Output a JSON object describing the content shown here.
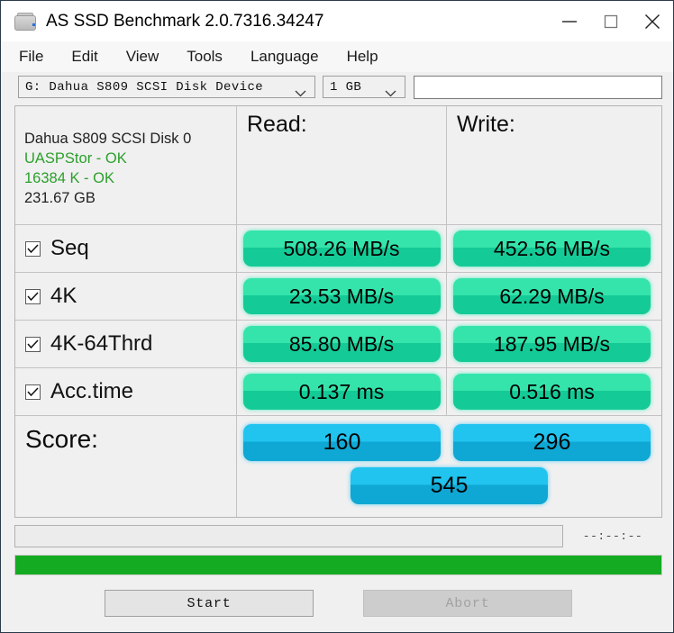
{
  "window": {
    "title": "AS SSD Benchmark 2.0.7316.34247",
    "icon": "ssd-drive-icon",
    "controls": {
      "minimize": "minimize-icon",
      "maximize": "maximize-icon",
      "close": "close-icon"
    }
  },
  "menu": {
    "items": [
      {
        "label": "File"
      },
      {
        "label": "Edit"
      },
      {
        "label": "View"
      },
      {
        "label": "Tools"
      },
      {
        "label": "Language"
      },
      {
        "label": "Help"
      }
    ]
  },
  "toolbar": {
    "drive_select": {
      "value": "G: Dahua S809 SCSI Disk Device",
      "icon": "chevron-down-icon"
    },
    "size_select": {
      "value": "1 GB",
      "icon": "chevron-down-icon"
    },
    "info_input": {
      "value": "",
      "placeholder": ""
    }
  },
  "disk_info": {
    "name": "Dahua S809 SCSI Disk 0",
    "driver": "UASPStor - OK",
    "alignment": "16384 K - OK",
    "capacity": "231.67 GB",
    "ok_color": "#2ca02c"
  },
  "columns": {
    "read": "Read:",
    "write": "Write:"
  },
  "results": {
    "rows": [
      {
        "label": "Seq",
        "checked": true,
        "read": "508.26 MB/s",
        "write": "452.56 MB/s"
      },
      {
        "label": "4K",
        "checked": true,
        "read": "23.53 MB/s",
        "write": "62.29 MB/s"
      },
      {
        "label": "4K-64Thrd",
        "checked": true,
        "read": "85.80 MB/s",
        "write": "187.95 MB/s"
      },
      {
        "label": "Acc.time",
        "checked": true,
        "read": "0.137 ms",
        "write": "0.516 ms"
      }
    ]
  },
  "score": {
    "label": "Score:",
    "read": "160",
    "write": "296",
    "total": "545"
  },
  "status": {
    "message": "",
    "elapsed": "--:--:--",
    "progress_percent": 100
  },
  "actions": {
    "start": "Start",
    "abort": "Abort"
  },
  "colors": {
    "pill_green_light": "#35e4ab",
    "pill_green_dark": "#14cb97",
    "pill_blue_light": "#21c3ef",
    "pill_blue_dark": "#0fa7d3",
    "progress_green": "#14ab23",
    "ok_green": "#2ca02c"
  }
}
